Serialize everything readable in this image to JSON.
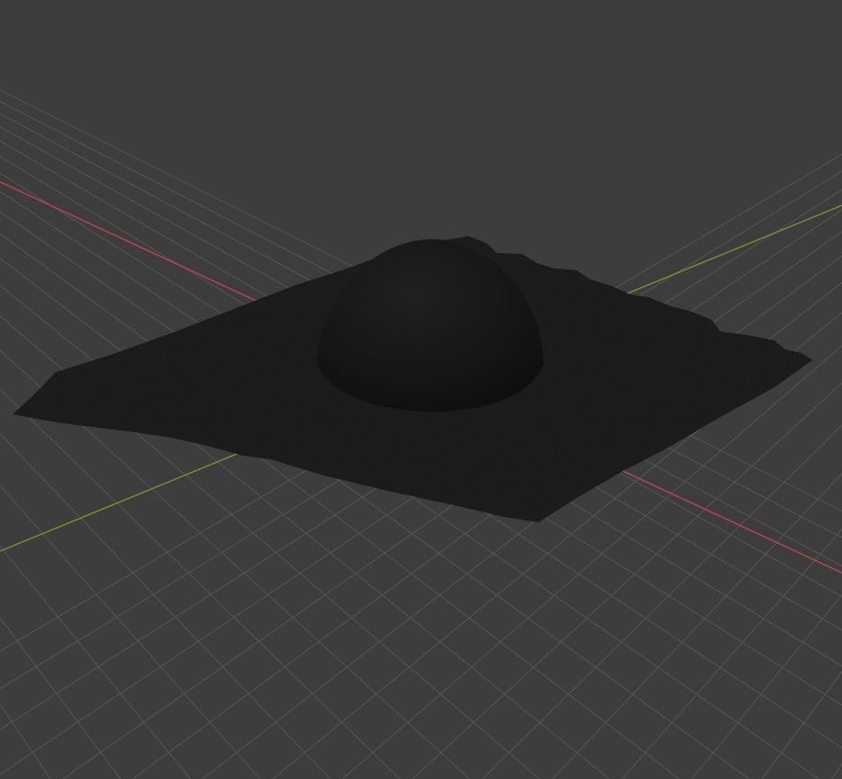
{
  "viewport": {
    "view": "3D Viewport",
    "background_color": "#3d3d3d",
    "grid_color": "#565656",
    "x_axis_color": "#b8484f",
    "y_axis_color": "#6c9a2e",
    "show_grid": true,
    "show_axes": [
      "x",
      "y"
    ]
  },
  "scene": {
    "objects": [
      {
        "name": "terrain-mesh",
        "type": "displaced-plane",
        "color": "#151515"
      },
      {
        "name": "sphere",
        "type": "uv-sphere",
        "color": "#161616",
        "shading": "smooth"
      }
    ]
  }
}
